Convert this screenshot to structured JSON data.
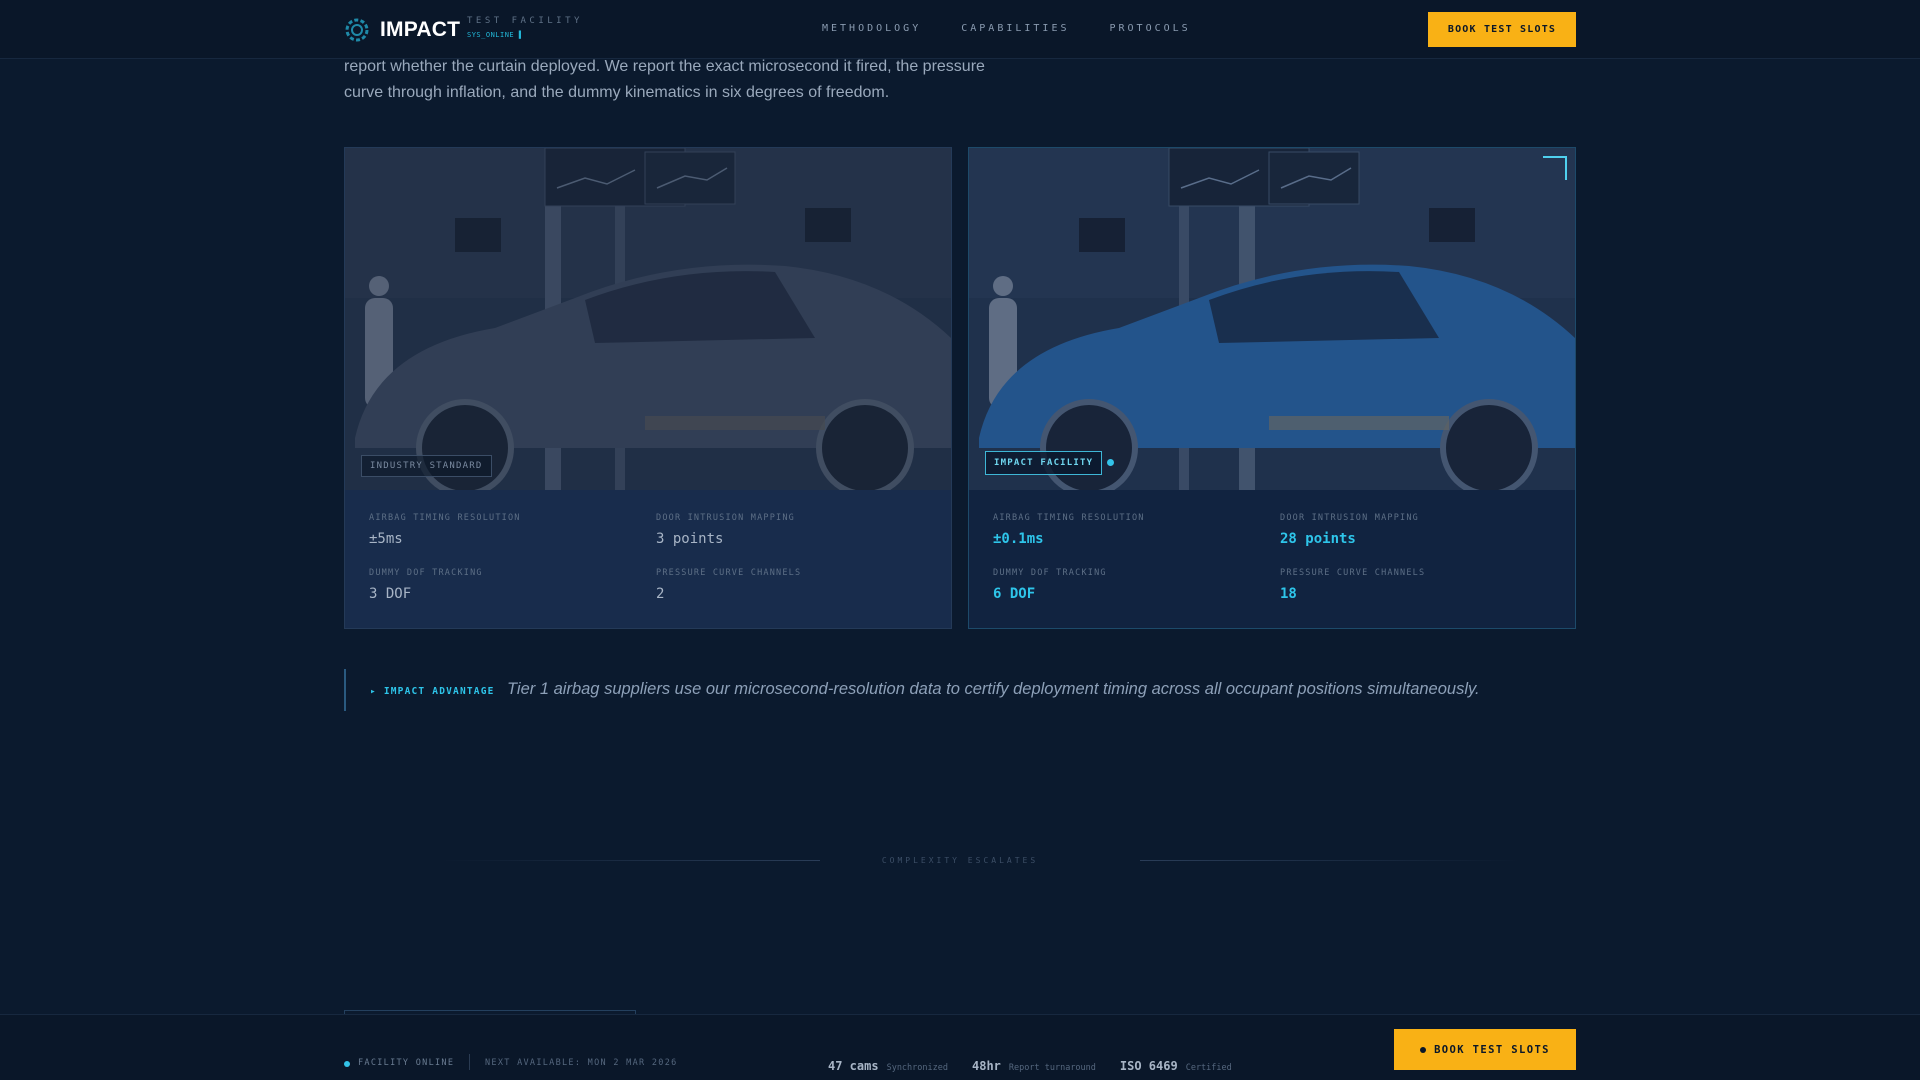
{
  "nav": {
    "brand": "IMPACT",
    "brand_sub": "TEST FACILITY",
    "status": "SYS_ONLINE ▌",
    "links": [
      "METHODOLOGY",
      "CAPABILITIES",
      "PROTOCOLS"
    ],
    "cta": "BOOK TEST SLOTS"
  },
  "intro": {
    "text": "report whether the curtain deployed. We report the exact microsecond it fired, the pressure curve through inflation, and the dummy kinematics in six degrees of freedom."
  },
  "cards": {
    "left": {
      "tag": "INDUSTRY STANDARD",
      "metrics": [
        {
          "label": "AIRBAG TIMING RESOLUTION",
          "value": "±5ms"
        },
        {
          "label": "DOOR INTRUSION MAPPING",
          "value": "3 points"
        },
        {
          "label": "DUMMY DOF TRACKING",
          "value": "3 DOF"
        },
        {
          "label": "PRESSURE CURVE CHANNELS",
          "value": "2"
        }
      ]
    },
    "right": {
      "tag": "IMPACT FACILITY",
      "metrics": [
        {
          "label": "AIRBAG TIMING RESOLUTION",
          "value": "±0.1ms"
        },
        {
          "label": "DOOR INTRUSION MAPPING",
          "value": "28 points"
        },
        {
          "label": "DUMMY DOF TRACKING",
          "value": "6 DOF"
        },
        {
          "label": "PRESSURE CURVE CHANNELS",
          "value": "18"
        }
      ]
    }
  },
  "advantage": {
    "label": "▸ IMPACT ADVANTAGE",
    "text": "Tier 1 airbag suppliers use our microsecond-resolution data to certify deployment timing across all occupant positions simultaneously."
  },
  "divider": {
    "text": "COMPLEXITY ESCALATES"
  },
  "footer": {
    "online": "FACILITY ONLINE",
    "next": "NEXT AVAILABLE: MON 2 MAR 2026",
    "stats": [
      {
        "value": "47 cams",
        "label": "Synchronized"
      },
      {
        "value": "48hr",
        "label": "Report turnaround"
      },
      {
        "value": "ISO 6469",
        "label": "Certified"
      }
    ],
    "cta": "BOOK TEST SLOTS"
  },
  "colors": {
    "accent": "#f9b115",
    "cyan": "#2ec5ea",
    "background": "#0b1a2e",
    "car_right": "#2c6cae",
    "car_left": "#4a5364"
  },
  "icons": {
    "logo": "aperture-icon"
  }
}
